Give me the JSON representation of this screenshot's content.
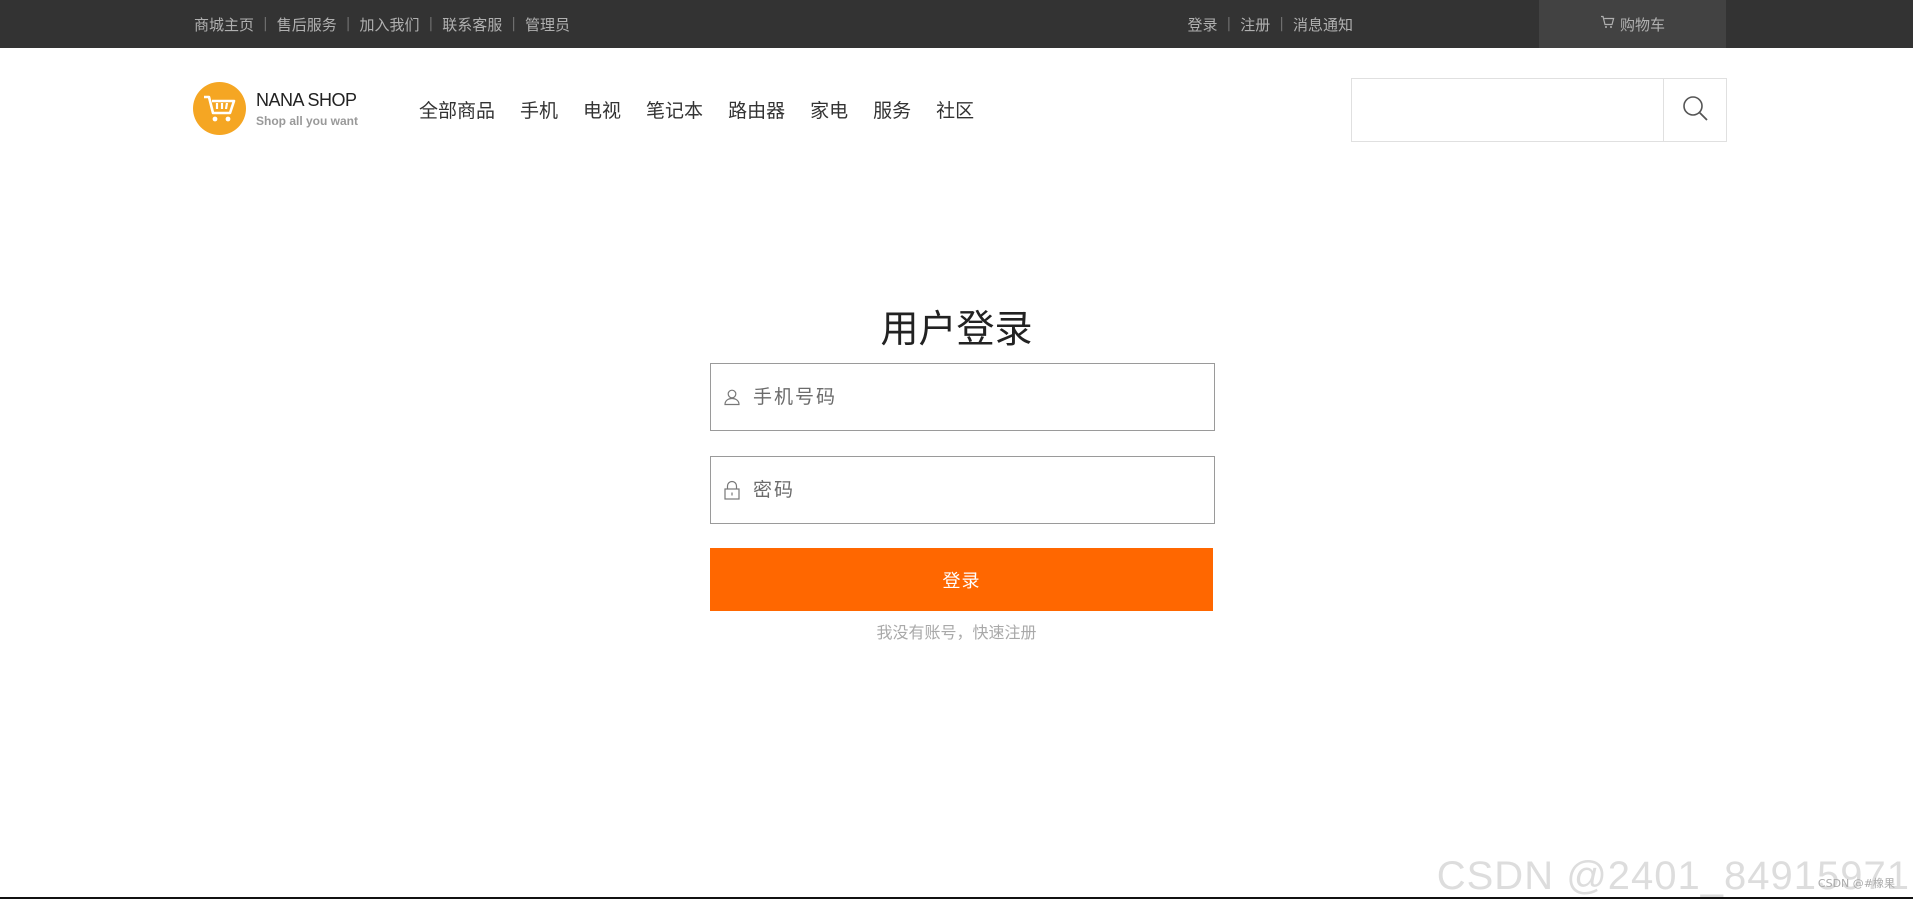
{
  "topbar": {
    "links": [
      "商城主页",
      "售后服务",
      "加入我们",
      "联系客服",
      "管理员"
    ],
    "login": "登录",
    "register": "注册",
    "messages": "消息通知",
    "cart": "购物车"
  },
  "header": {
    "logo_name": "NANA SHOP",
    "logo_slogan": "Shop all you want",
    "nav": [
      "全部商品",
      "手机",
      "电视",
      "笔记本",
      "路由器",
      "家电",
      "服务",
      "社区"
    ],
    "search": {
      "placeholder": ""
    }
  },
  "login": {
    "title": "用户登录",
    "phone_placeholder": "手机号码",
    "password_placeholder": "密码",
    "submit_label": "登录",
    "register_text": "我没有账号，快速注册"
  },
  "watermark": {
    "big": "CSDN @2401_84915971",
    "small": "CSDN @#橡果"
  },
  "colors": {
    "topbar_bg": "#333333",
    "accent": "#ff6700",
    "logo": "#f5a623"
  },
  "icons": [
    "cart-icon",
    "logo-cart-icon",
    "search-icon",
    "user-icon",
    "lock-icon"
  ]
}
